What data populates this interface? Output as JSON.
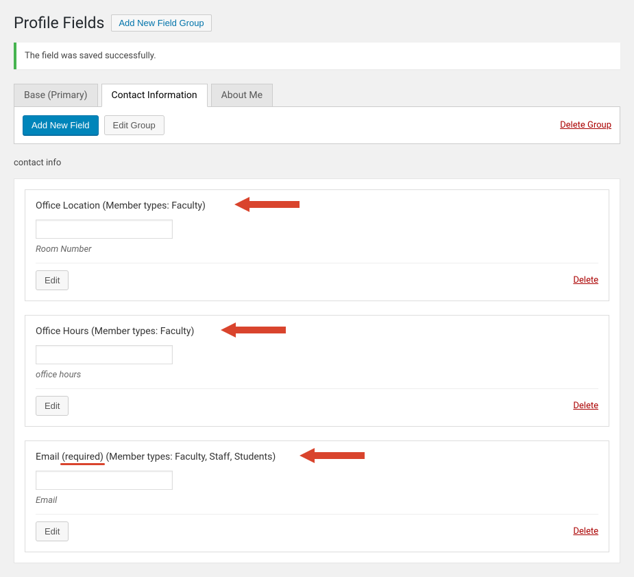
{
  "header": {
    "title": "Profile Fields",
    "addNewGroup": "Add New Field Group"
  },
  "notice": {
    "message": "The field was saved successfully."
  },
  "tabs": [
    {
      "label": "Base (Primary)",
      "active": false
    },
    {
      "label": "Contact Information",
      "active": true
    },
    {
      "label": "About Me",
      "active": false
    }
  ],
  "actions": {
    "addNewField": "Add New Field",
    "editGroup": "Edit Group",
    "deleteGroup": "Delete Group"
  },
  "subtitle": "contact info",
  "common": {
    "edit": "Edit",
    "delete": "Delete"
  },
  "fields": [
    {
      "title": "Office Location (Member types: Faculty)",
      "desc": "Room Number",
      "arrowLeft": 305
    },
    {
      "title": "Office Hours (Member types: Faculty)",
      "desc": "office hours",
      "arrowLeft": 285
    },
    {
      "titlePrefix": "Email ",
      "required": "(required)",
      "titleSuffix": " (Member types: Faculty, Staff, Students)",
      "desc": "Email",
      "arrowLeft": 400
    }
  ]
}
